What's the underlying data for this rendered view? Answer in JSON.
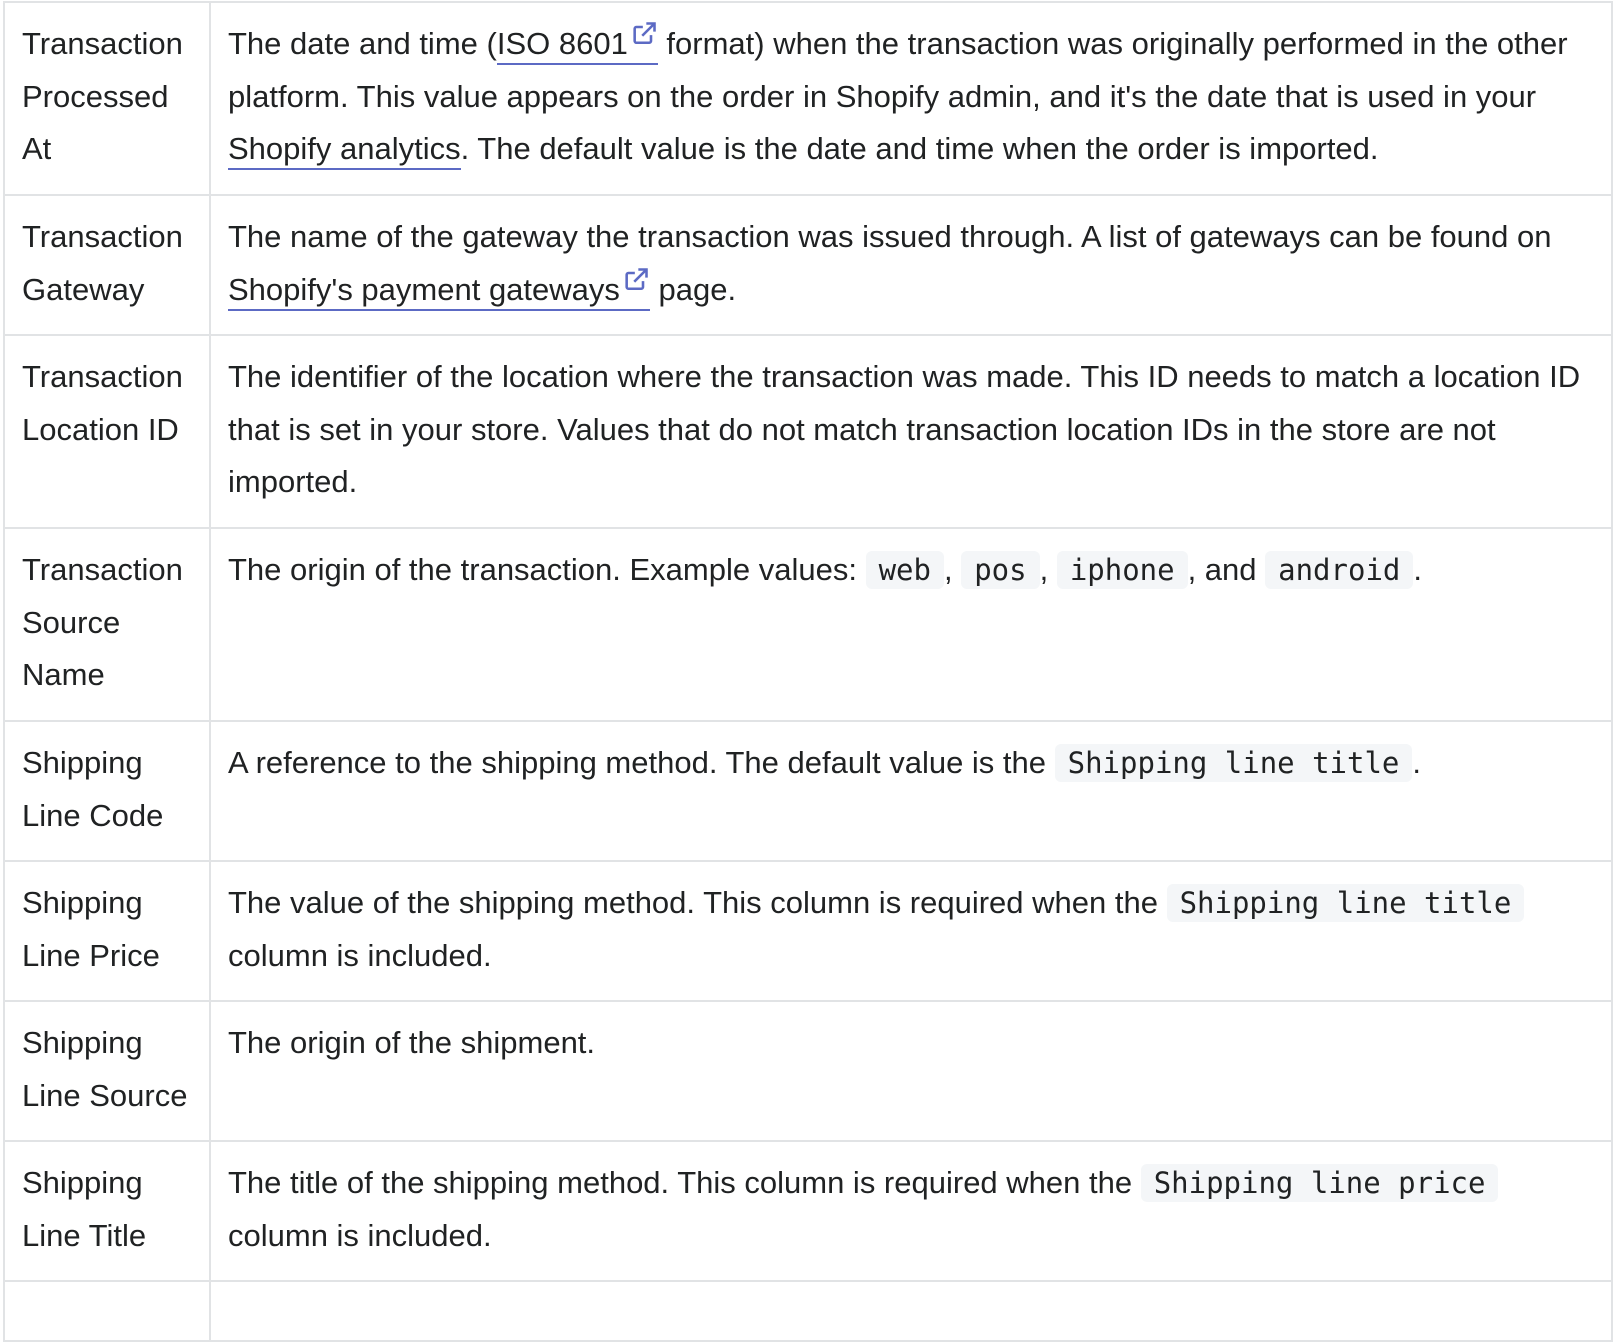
{
  "colors": {
    "border": "#e1e3e5",
    "link_underline": "#5c6ac4",
    "code_background": "#f4f6f8",
    "text": "#202223"
  },
  "rows": [
    {
      "name": "Transaction Processed At",
      "desc": {
        "t1": "The date and time (",
        "link": "ISO 8601",
        "t2": " format) when the transaction was originally performed in the other platform. This value appears on the order in Shopify admin, and it's the date that is used in your ",
        "link2": "Shopify analytics",
        "t3": ". The default value is the date and time when the order is imported."
      }
    },
    {
      "name": "Transaction Gateway",
      "desc": {
        "t1": "The name of the gateway the transaction was issued through. A list of gateways can be found on ",
        "link": "Shopify's payment gateways",
        "t2": " page."
      }
    },
    {
      "name": "Transaction Location ID",
      "desc": {
        "t1": "The identifier of the location where the transaction was made. This ID needs to match a location ID that is set in your store. Values that do not match transaction location IDs in the store are not imported."
      }
    },
    {
      "name": "Transaction Source Name",
      "desc": {
        "t1": "The origin of the transaction. Example values: ",
        "codes": [
          "web",
          "pos",
          "iphone",
          "android"
        ],
        "sep1": ", ",
        "sep2": ", ",
        "sep3": ", and ",
        "t2": "."
      }
    },
    {
      "name": "Shipping Line Code",
      "desc": {
        "t1": "A reference to the shipping method. The default value is the ",
        "code": "Shipping line title",
        "t2": "."
      }
    },
    {
      "name": "Shipping Line Price",
      "desc": {
        "t1": "The value of the shipping method. This column is required when the ",
        "code": "Shipping line title",
        "t2": " column is included."
      }
    },
    {
      "name": "Shipping Line Source",
      "desc": {
        "t1": "The origin of the shipment."
      }
    },
    {
      "name": "Shipping Line Title",
      "desc": {
        "t1": "The title of the shipping method. This column is required when the ",
        "code": "Shipping line price",
        "t2": " column is included."
      }
    }
  ]
}
